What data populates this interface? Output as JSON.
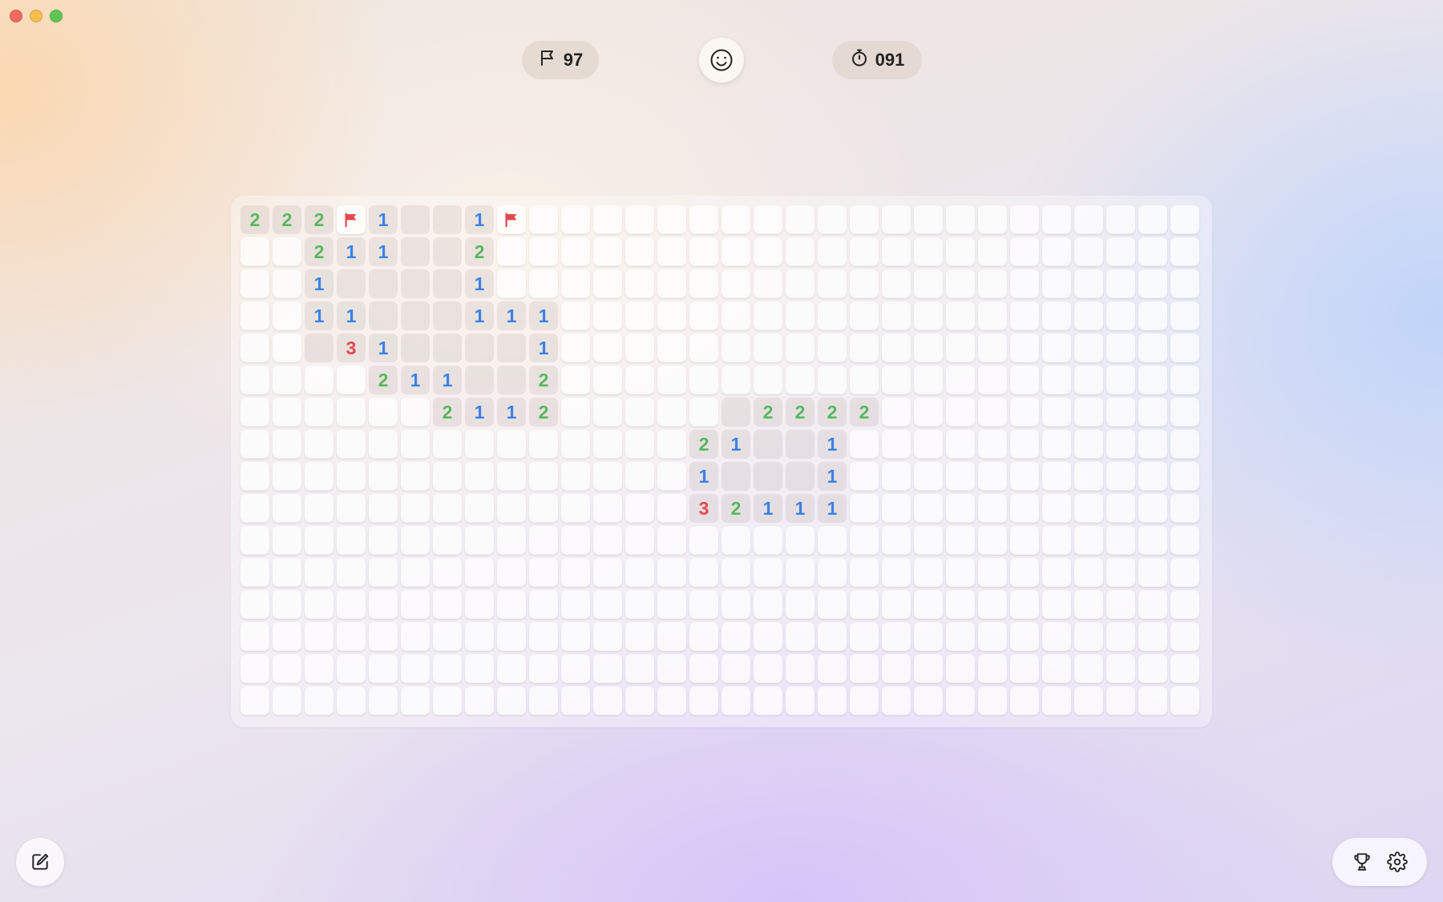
{
  "window": {
    "traffic_lights": [
      "close",
      "minimize",
      "maximize"
    ]
  },
  "toolbar": {
    "flags_remaining": "97",
    "flag_icon": "flag-icon",
    "face_icon": "smiley-face-icon",
    "timer": "091",
    "timer_icon": "stopwatch-icon"
  },
  "board": {
    "rows": 16,
    "cols": 30,
    "legend": "h = hidden, o = opened empty, f = flag, 1-9 = opened number",
    "grid": [
      "222f1oo1fhhhhhhhhhhhhhhhhhhhhh",
      "hh211oo2hhhhhhhhhhhhhhhhhhhhhh",
      "hh1oooo1hhhhhhhhhhhhhhhhhhhhhh",
      "hh11ooo111hhhhhhhhhhhhhhhhhhhh",
      "hho31oooo1hhhhhhhhhhhhhhhhhhhh",
      "hhhh211oo2hhhhhhhhhhhhhhhhhhhh",
      "hhhhhh2112hhhhho2222hhhhhhhhhh",
      "hhhhhhhhhhhhhh21oo1hhhhhhhhhhh",
      "hhhhhhhhhhhhhh1ooo1hhhhhhhhhhh",
      "hhhhhhhhhhhhhh32111hhhhhhhhhhh",
      "hhhhhhhhhhhhhhhhhhhhhhhhhhhhhh",
      "hhhhhhhhhhhhhhhhhhhhhhhhhhhhhh",
      "hhhhhhhhhhhhhhhhhhhhhhhhhhhhhh",
      "hhhhhhhhhhhhhhhhhhhhhhhhhhhhhh",
      "hhhhhhhhhhhhhhhhhhhhhhhhhhhhhh",
      "hhhhhhhhhhhhhhhhhhhhhhhhhhhhhh"
    ],
    "number_colors": {
      "1": "#3b82e6",
      "2": "#58b85c",
      "3": "#e5484d"
    },
    "flag_color": "#e5484d"
  },
  "bottom": {
    "left_icon": "edit-icon",
    "right_icons": [
      "trophy-icon",
      "gear-icon"
    ]
  }
}
